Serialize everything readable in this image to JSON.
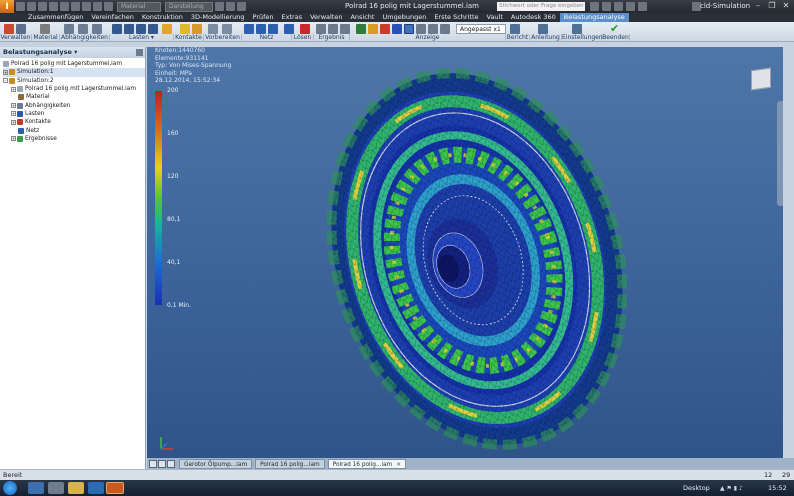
{
  "window": {
    "doc_title": "Polrad 16 polig mit Lagerstummel.iam",
    "search_placeholder": "Stichwort oder Frage eingeben",
    "user": "cld-Simulation",
    "material_combo": "Material",
    "appearance_combo": "Darstellung"
  },
  "ribbon": {
    "tabs": [
      "Zusammenfügen",
      "Vereinfachen",
      "Konstruktion",
      "3D-Modellierung",
      "Prüfen",
      "Extras",
      "Verwalten",
      "Ansicht",
      "Umgebungen",
      "Erste Schritte",
      "Vault",
      "Autodesk 360",
      "Belastungsanalyse"
    ],
    "active_tab": "Belastungsanalyse",
    "panels": [
      "Verwalten",
      "Material",
      "Abhängigkeiten",
      "Lasten ▾",
      "Kontakte",
      "Vorbereiten",
      "Netz",
      "Lösen",
      "Ergebnis",
      "Anzeige",
      "Bericht",
      "Anleitung",
      "Einstellungen",
      "Beenden"
    ],
    "scale_combo": "Angepasst x1"
  },
  "browser": {
    "title": "Belastungsanalyse ▾",
    "items": [
      {
        "label": "Polrad 16 polig mit Lagerstummel.iam",
        "indent": 0
      },
      {
        "label": "Simulation:1",
        "indent": 0
      },
      {
        "label": "Simulation:2",
        "indent": 0
      },
      {
        "label": "Polrad 16 polig mit Lagerstummel.iam",
        "indent": 1
      },
      {
        "label": "Material",
        "indent": 1
      },
      {
        "label": "Abhängigkeiten",
        "indent": 1
      },
      {
        "label": "Lasten",
        "indent": 1
      },
      {
        "label": "Kontakte",
        "indent": 1
      },
      {
        "label": "Netz",
        "indent": 1
      },
      {
        "label": "Ergebnisse",
        "indent": 1
      }
    ]
  },
  "viewport": {
    "info": [
      "Knoten:1440760",
      "Elemente:931141",
      "Typ: Von Mises-Spannung",
      "Einheit: MPa",
      "28.12.2014, 15:52:34"
    ],
    "legend": [
      "200",
      "160",
      "120",
      "80,1",
      "40,1",
      "0,1 Min."
    ]
  },
  "doc_tabs": [
    "Gerotor Ölpump...iam",
    "Polrad 16 polig...iam",
    "Polrad 16 polig...iam"
  ],
  "status": {
    "text": "Bereit",
    "num1": "12",
    "num2": "29"
  },
  "taskbar": {
    "desktop": "Desktop",
    "clock": "15:52"
  }
}
